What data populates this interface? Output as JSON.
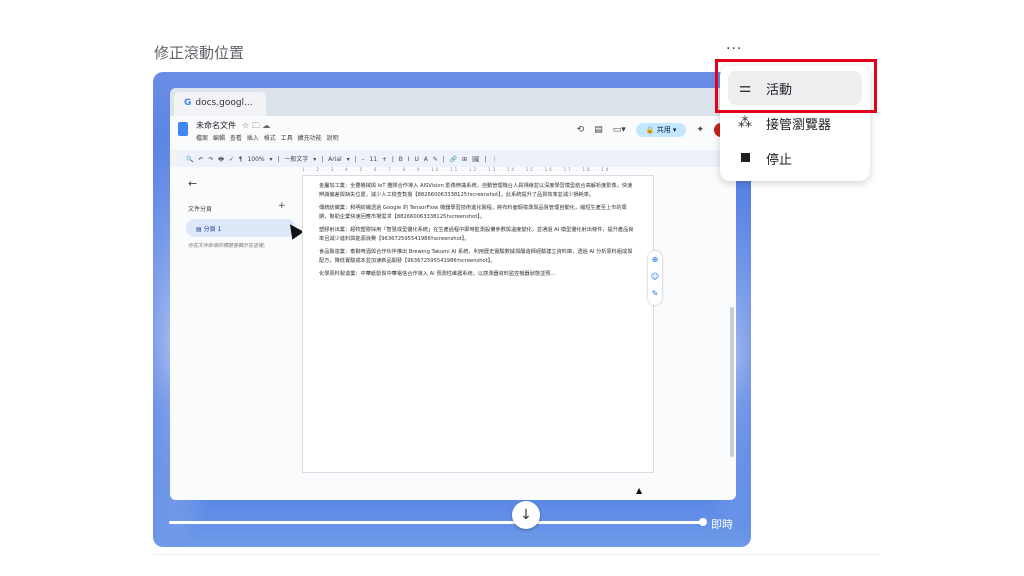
{
  "header": {
    "title": "修正滾動位置",
    "more_icon": "more-horizontal-icon",
    "more_glyph": "···"
  },
  "browser": {
    "tab_label": "docs.googl...",
    "docs": {
      "doc_title": "未命名文件",
      "title_icons": "☆ 🗀 ☁",
      "menu": [
        "檔案",
        "編輯",
        "查看",
        "插入",
        "格式",
        "工具",
        "擴充功能",
        "說明"
      ],
      "share_label": "共用",
      "toolbar_text": "🔍  ↶  ↷  🖶  ✓  ¶  100% ▾  |  一般文字 ▾  |  Arial ▾  |  –  11  +  |  B  I  U  A  ✎  |  🔗  ⊞  🖼  |  ⋮",
      "outline": {
        "title": "文件分頁",
        "item": "分頁 1",
        "hint": "你在文件新增的標題會顯示在這裡。"
      },
      "ruler": "1 . 2 . 3 . 4 . 5 . 6 . 7 . 8 . 9 . 10 . 11 . 12 . 13 . 14 . 15 . 16 . 17 . 18 . 19",
      "paragraphs": [
        "金屬加工業：全豐機械與 IoT 團隊合作導入 AISVision 影像辨識系統，自動管理機台人員視線並以深度學習模型結合高解析度影像，快速辨識偏差與缺失位置，減少人工檢查負擔【882660063338125†screenshot】，此系統提升了品質效率並減少損耗率。",
        "傳統紡織業：和明紡織透過 Google 的 TensorFlow 機器學習技術進化製程，將布料面瑕檢測與品質管理自動化，縮短生產至上市的周期，幫助企業快速回應市場需求【882660063338125†screenshot】。",
        "塑膠射出業：超牧塑膠採用「智慧成型優化系統」在生產過程中即時監測設備參數與溫度變化，並通過 AI 模型優化射出條件，提升產品良率且減少進料與能源浪費【963672595541986†screenshot】。",
        "食品製造業：泰聯啤酒與合作伙伴推出 Brewing Takumi AI 系統，利用歷史實驗數據與釀造師經驗建立資料庫，透過 AI 分析原料組成與配方，降低實驗成本並加速新品開發【963672595541986†screenshot】。",
        "化學原料製造業：中華紙漿與中華電信合作導入 AI 預測性維護系統，以感測器資料監控機器狀態並預..."
      ]
    }
  },
  "timeline": {
    "live_label": "即時",
    "progress_pct": 100
  },
  "menu": {
    "items": [
      {
        "label": "活動",
        "icon": "activity-lines-icon"
      },
      {
        "label": "接管瀏覽器",
        "icon": "take-control-cursor-icon"
      },
      {
        "label": "停止",
        "icon": "stop-square-icon"
      }
    ]
  }
}
